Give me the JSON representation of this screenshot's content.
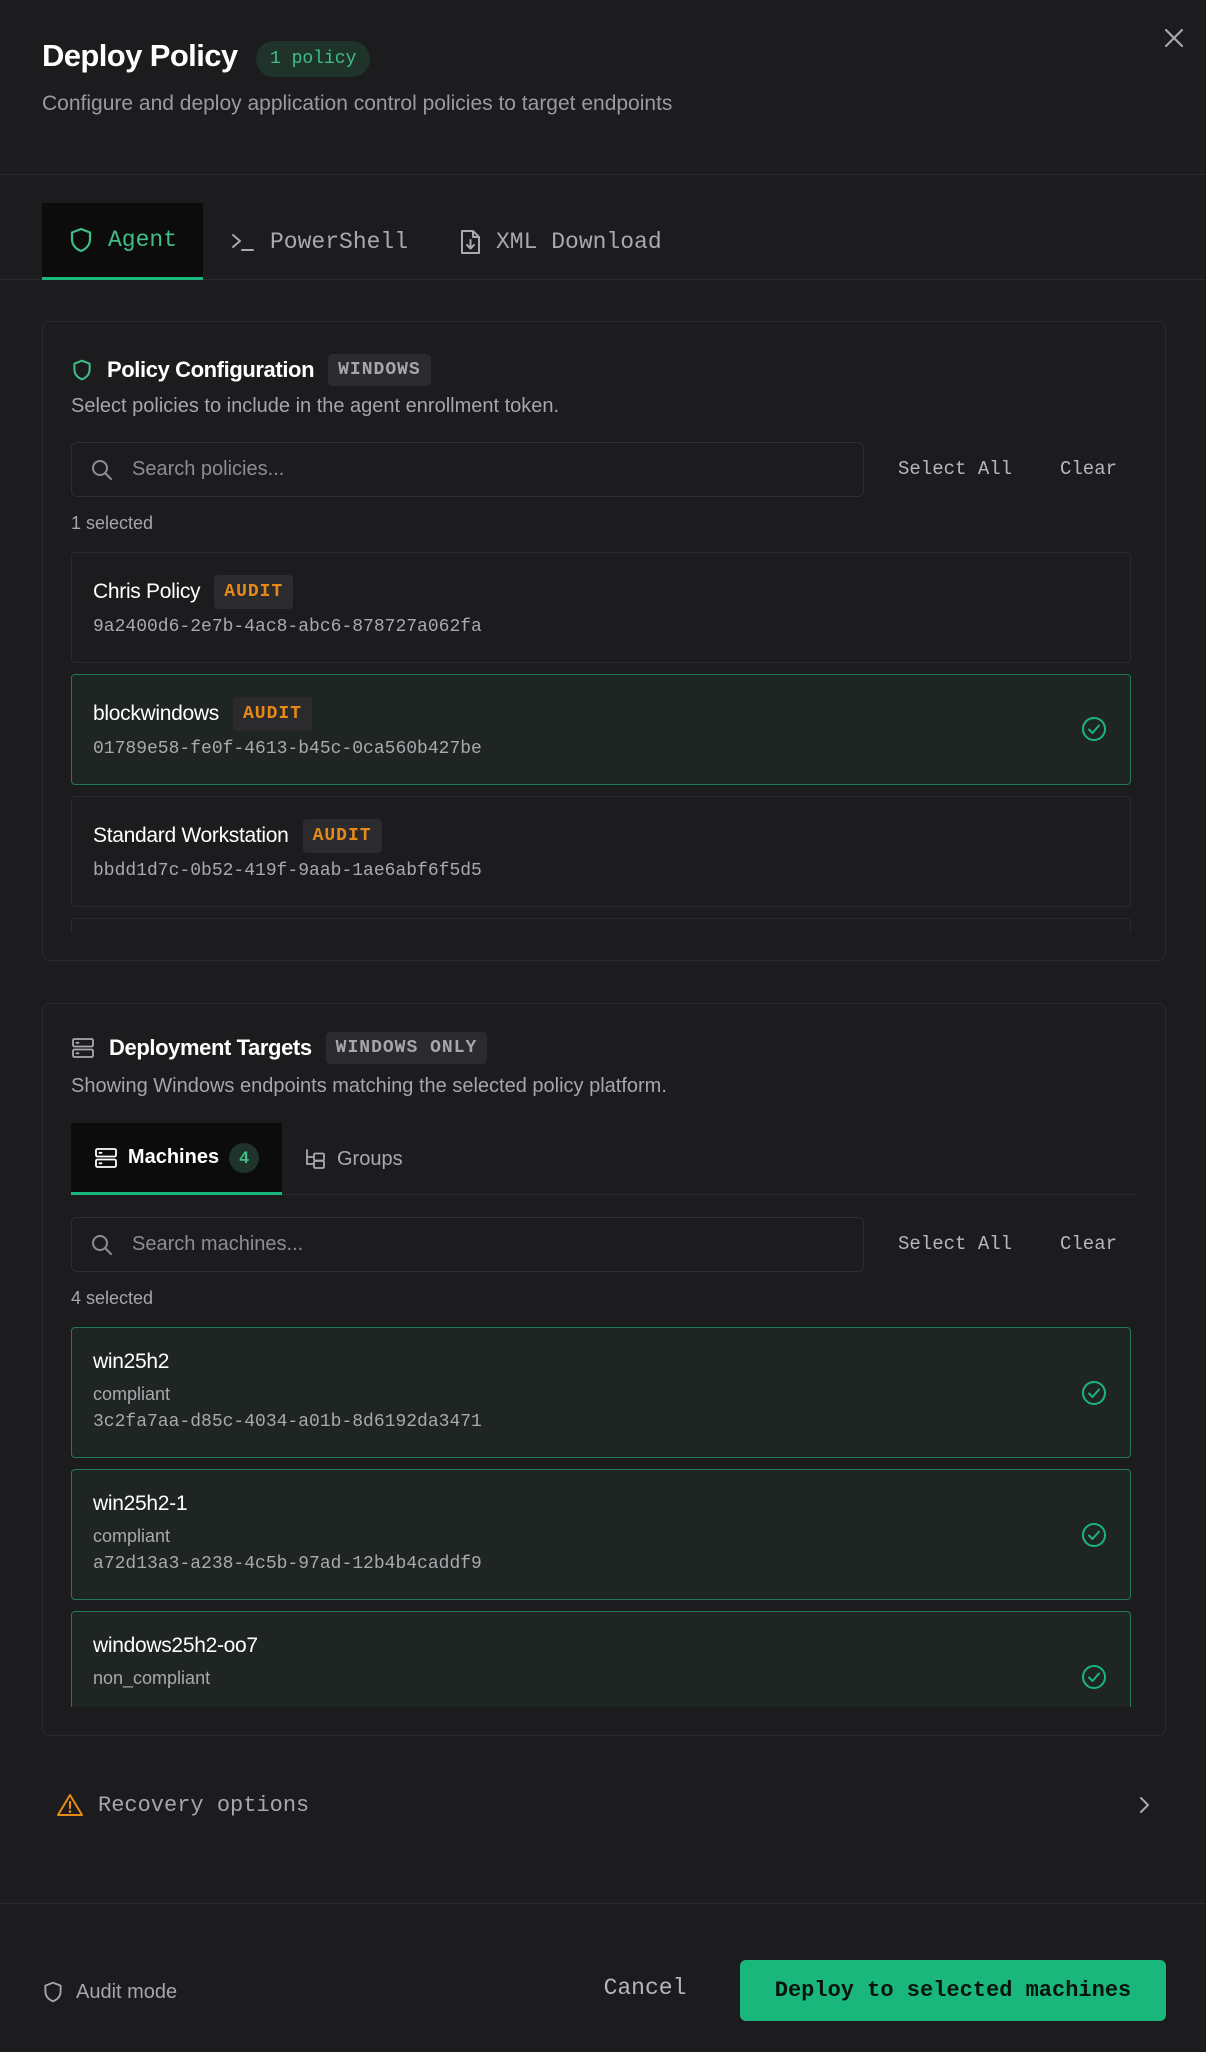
{
  "header": {
    "title": "Deploy Policy",
    "policy_count": "1 policy",
    "subtitle": "Configure and deploy application control policies to target endpoints"
  },
  "tabs": [
    {
      "label": "Agent",
      "icon": "shield-icon",
      "active": true
    },
    {
      "label": "PowerShell",
      "icon": "terminal-icon",
      "active": false
    },
    {
      "label": "XML Download",
      "icon": "file-download-icon",
      "active": false
    }
  ],
  "policy_config": {
    "title": "Policy Configuration",
    "platform_tag": "WINDOWS",
    "description": "Select policies to include in the agent enrollment token.",
    "search_placeholder": "Search policies...",
    "select_all": "Select All",
    "clear": "Clear",
    "selected_count": "1 selected",
    "policies": [
      {
        "name": "Chris Policy",
        "mode": "AUDIT",
        "id": "9a2400d6-2e7b-4ac8-abc6-878727a062fa",
        "selected": false
      },
      {
        "name": "blockwindows",
        "mode": "AUDIT",
        "id": "01789e58-fe0f-4613-b45c-0ca560b427be",
        "selected": true
      },
      {
        "name": "Standard Workstation",
        "mode": "AUDIT",
        "id": "bbdd1d7c-0b52-419f-9aab-1ae6abf6f5d5",
        "selected": false
      }
    ]
  },
  "targets": {
    "title": "Deployment Targets",
    "platform_tag": "WINDOWS ONLY",
    "description": "Showing Windows endpoints matching the selected policy platform.",
    "tabs": {
      "machines": "Machines",
      "machines_count": "4",
      "groups": "Groups"
    },
    "search_placeholder": "Search machines...",
    "select_all": "Select All",
    "clear": "Clear",
    "selected_count": "4 selected",
    "machines": [
      {
        "name": "win25h2",
        "status": "compliant",
        "id": "3c2fa7aa-d85c-4034-a01b-8d6192da3471",
        "selected": true
      },
      {
        "name": "win25h2-1",
        "status": "compliant",
        "id": "a72d13a3-a238-4c5b-97ad-12b4b4caddf9",
        "selected": true
      },
      {
        "name": "windows25h2-oo7",
        "status": "non_compliant",
        "id": "",
        "selected": true
      }
    ]
  },
  "recovery": {
    "label": "Recovery options"
  },
  "footer": {
    "audit_mode": "Audit mode",
    "cancel": "Cancel",
    "deploy": "Deploy to selected machines"
  },
  "colors": {
    "accent": "#19b77c",
    "audit": "#e58a17",
    "background": "#1c1c1e",
    "warning": "#e58a17"
  }
}
